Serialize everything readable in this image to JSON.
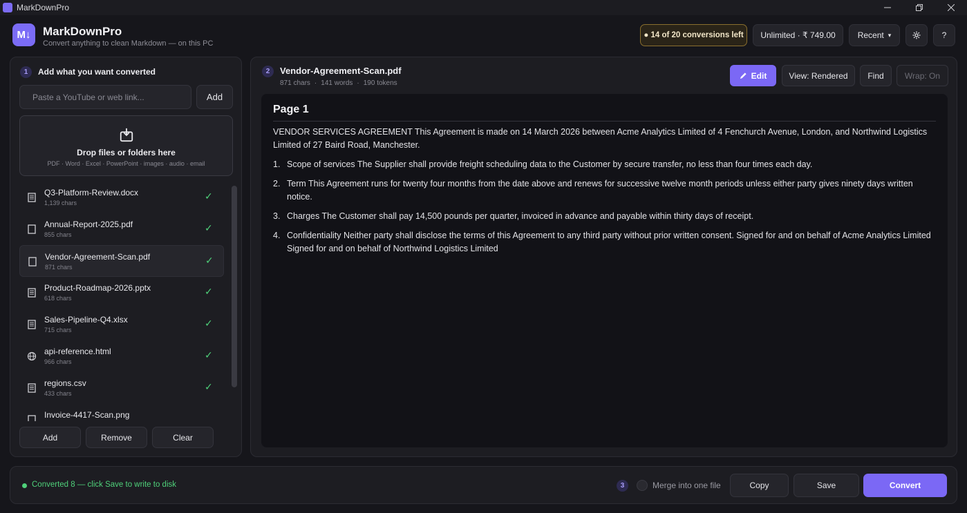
{
  "window": {
    "title": "MarkDownPro",
    "min_icon": "minimize-icon",
    "max_icon": "restore-icon",
    "close_icon": "close-icon"
  },
  "header": {
    "logo_text": "M↓",
    "app_name": "MarkDownPro",
    "tagline": "Convert anything to clean Markdown — on this PC",
    "quota": "● 14 of 20 conversions left",
    "unlimited": "Unlimited · ₹ 749.00",
    "recent": "Recent",
    "recent_caret": "▾",
    "settings_icon": "gear-icon",
    "help": "?"
  },
  "left": {
    "step": "1",
    "title": "Add what you want converted",
    "url_placeholder": "Paste a YouTube or web link...",
    "add_link_label": "Add",
    "dropzone_title": "Drop files or folders here",
    "dropzone_sub": "PDF · Word · Excel · PowerPoint · images · audio · email",
    "files": [
      {
        "name": "Q3-Platform-Review.docx",
        "size": "1,139 chars",
        "icon": "doc-icon",
        "done": "✓"
      },
      {
        "name": "Annual-Report-2025.pdf",
        "size": "855 chars",
        "icon": "pdf-icon",
        "done": "✓"
      },
      {
        "name": "Vendor-Agreement-Scan.pdf",
        "size": "871 chars",
        "icon": "pdf-icon",
        "done": "✓"
      },
      {
        "name": "Product-Roadmap-2026.pptx",
        "size": "618 chars",
        "icon": "doc-icon",
        "done": "✓"
      },
      {
        "name": "Sales-Pipeline-Q4.xlsx",
        "size": "715 chars",
        "icon": "doc-icon",
        "done": "✓"
      },
      {
        "name": "api-reference.html",
        "size": "966 chars",
        "icon": "globe-icon",
        "done": "✓"
      },
      {
        "name": "regions.csv",
        "size": "433 chars",
        "icon": "doc-icon",
        "done": "✓"
      },
      {
        "name": "Invoice-4417-Scan.png",
        "size": "",
        "icon": "doc-icon",
        "done": ""
      }
    ],
    "buttons": {
      "add": "Add",
      "remove": "Remove",
      "clear": "Clear"
    }
  },
  "right": {
    "step": "2",
    "doc_title": "Vendor-Agreement-Scan.pdf",
    "meta": {
      "chars": "871 chars",
      "words": "141 words",
      "tokens": "190 tokens",
      "sep": "·"
    },
    "toolbar": {
      "edit": "Edit",
      "edit_icon": "pencil-icon",
      "view": "View: Rendered",
      "find": "Find",
      "wrap": "Wrap: On"
    },
    "document": {
      "page_heading": "Page 1",
      "intro": "VENDOR SERVICES AGREEMENT This Agreement is made on 14 March 2026 between Acme Analytics Limited of 4 Fenchurch Avenue, London, and Northwind Logistics Limited of 27 Baird Road, Manchester.",
      "items": [
        {
          "num": "1.",
          "text": "Scope of services The Supplier shall provide freight scheduling data to the Customer by secure transfer, no less than four times each day."
        },
        {
          "num": "2.",
          "text": "Term This Agreement runs for twenty four months from the date above and renews for successive twelve month periods unless either party gives ninety days written notice."
        },
        {
          "num": "3.",
          "text": "Charges The Customer shall pay 14,500 pounds per quarter, invoiced in advance and payable within thirty days of receipt."
        },
        {
          "num": "4.",
          "text": "Confidentiality Neither party shall disclose the terms of this Agreement to any third party without prior written consent. Signed for and on behalf of Acme Analytics Limited Signed for and on behalf of Northwind Logistics Limited"
        }
      ]
    }
  },
  "bottom": {
    "status": "Converted 8 — click Save to write to disk",
    "step": "3",
    "merge_label": "Merge into one file",
    "copy": "Copy",
    "save": "Save",
    "convert": "Convert"
  },
  "colors": {
    "accent": "#7b68f5",
    "success": "#4fd17a",
    "quota_border": "#8a6f2e"
  }
}
